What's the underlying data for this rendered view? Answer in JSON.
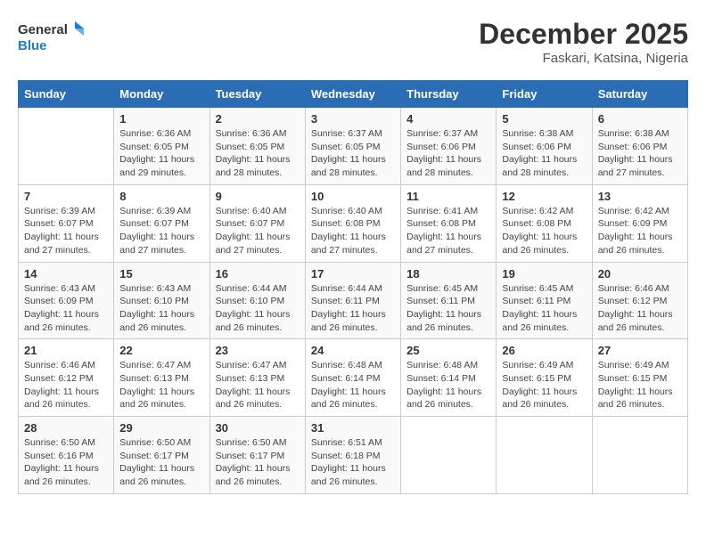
{
  "logo": {
    "line1": "General",
    "line2": "Blue"
  },
  "title": "December 2025",
  "location": "Faskari, Katsina, Nigeria",
  "weekdays": [
    "Sunday",
    "Monday",
    "Tuesday",
    "Wednesday",
    "Thursday",
    "Friday",
    "Saturday"
  ],
  "weeks": [
    [
      {
        "day": "",
        "info": ""
      },
      {
        "day": "1",
        "info": "Sunrise: 6:36 AM\nSunset: 6:05 PM\nDaylight: 11 hours\nand 29 minutes."
      },
      {
        "day": "2",
        "info": "Sunrise: 6:36 AM\nSunset: 6:05 PM\nDaylight: 11 hours\nand 28 minutes."
      },
      {
        "day": "3",
        "info": "Sunrise: 6:37 AM\nSunset: 6:05 PM\nDaylight: 11 hours\nand 28 minutes."
      },
      {
        "day": "4",
        "info": "Sunrise: 6:37 AM\nSunset: 6:06 PM\nDaylight: 11 hours\nand 28 minutes."
      },
      {
        "day": "5",
        "info": "Sunrise: 6:38 AM\nSunset: 6:06 PM\nDaylight: 11 hours\nand 28 minutes."
      },
      {
        "day": "6",
        "info": "Sunrise: 6:38 AM\nSunset: 6:06 PM\nDaylight: 11 hours\nand 27 minutes."
      }
    ],
    [
      {
        "day": "7",
        "info": "Sunrise: 6:39 AM\nSunset: 6:07 PM\nDaylight: 11 hours\nand 27 minutes."
      },
      {
        "day": "8",
        "info": "Sunrise: 6:39 AM\nSunset: 6:07 PM\nDaylight: 11 hours\nand 27 minutes."
      },
      {
        "day": "9",
        "info": "Sunrise: 6:40 AM\nSunset: 6:07 PM\nDaylight: 11 hours\nand 27 minutes."
      },
      {
        "day": "10",
        "info": "Sunrise: 6:40 AM\nSunset: 6:08 PM\nDaylight: 11 hours\nand 27 minutes."
      },
      {
        "day": "11",
        "info": "Sunrise: 6:41 AM\nSunset: 6:08 PM\nDaylight: 11 hours\nand 27 minutes."
      },
      {
        "day": "12",
        "info": "Sunrise: 6:42 AM\nSunset: 6:08 PM\nDaylight: 11 hours\nand 26 minutes."
      },
      {
        "day": "13",
        "info": "Sunrise: 6:42 AM\nSunset: 6:09 PM\nDaylight: 11 hours\nand 26 minutes."
      }
    ],
    [
      {
        "day": "14",
        "info": "Sunrise: 6:43 AM\nSunset: 6:09 PM\nDaylight: 11 hours\nand 26 minutes."
      },
      {
        "day": "15",
        "info": "Sunrise: 6:43 AM\nSunset: 6:10 PM\nDaylight: 11 hours\nand 26 minutes."
      },
      {
        "day": "16",
        "info": "Sunrise: 6:44 AM\nSunset: 6:10 PM\nDaylight: 11 hours\nand 26 minutes."
      },
      {
        "day": "17",
        "info": "Sunrise: 6:44 AM\nSunset: 6:11 PM\nDaylight: 11 hours\nand 26 minutes."
      },
      {
        "day": "18",
        "info": "Sunrise: 6:45 AM\nSunset: 6:11 PM\nDaylight: 11 hours\nand 26 minutes."
      },
      {
        "day": "19",
        "info": "Sunrise: 6:45 AM\nSunset: 6:11 PM\nDaylight: 11 hours\nand 26 minutes."
      },
      {
        "day": "20",
        "info": "Sunrise: 6:46 AM\nSunset: 6:12 PM\nDaylight: 11 hours\nand 26 minutes."
      }
    ],
    [
      {
        "day": "21",
        "info": "Sunrise: 6:46 AM\nSunset: 6:12 PM\nDaylight: 11 hours\nand 26 minutes."
      },
      {
        "day": "22",
        "info": "Sunrise: 6:47 AM\nSunset: 6:13 PM\nDaylight: 11 hours\nand 26 minutes."
      },
      {
        "day": "23",
        "info": "Sunrise: 6:47 AM\nSunset: 6:13 PM\nDaylight: 11 hours\nand 26 minutes."
      },
      {
        "day": "24",
        "info": "Sunrise: 6:48 AM\nSunset: 6:14 PM\nDaylight: 11 hours\nand 26 minutes."
      },
      {
        "day": "25",
        "info": "Sunrise: 6:48 AM\nSunset: 6:14 PM\nDaylight: 11 hours\nand 26 minutes."
      },
      {
        "day": "26",
        "info": "Sunrise: 6:49 AM\nSunset: 6:15 PM\nDaylight: 11 hours\nand 26 minutes."
      },
      {
        "day": "27",
        "info": "Sunrise: 6:49 AM\nSunset: 6:15 PM\nDaylight: 11 hours\nand 26 minutes."
      }
    ],
    [
      {
        "day": "28",
        "info": "Sunrise: 6:50 AM\nSunset: 6:16 PM\nDaylight: 11 hours\nand 26 minutes."
      },
      {
        "day": "29",
        "info": "Sunrise: 6:50 AM\nSunset: 6:17 PM\nDaylight: 11 hours\nand 26 minutes."
      },
      {
        "day": "30",
        "info": "Sunrise: 6:50 AM\nSunset: 6:17 PM\nDaylight: 11 hours\nand 26 minutes."
      },
      {
        "day": "31",
        "info": "Sunrise: 6:51 AM\nSunset: 6:18 PM\nDaylight: 11 hours\nand 26 minutes."
      },
      {
        "day": "",
        "info": ""
      },
      {
        "day": "",
        "info": ""
      },
      {
        "day": "",
        "info": ""
      }
    ]
  ]
}
